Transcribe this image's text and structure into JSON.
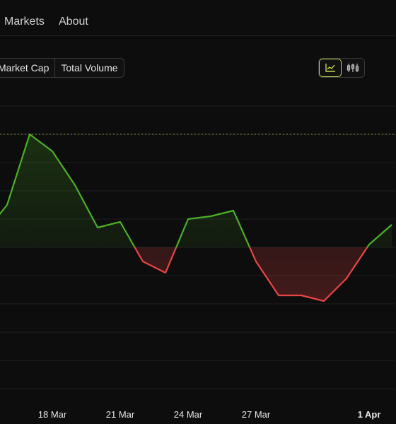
{
  "nav": {
    "markets_label": "Markets",
    "about_label": "About"
  },
  "toggle": {
    "market_cap_label": "Market Cap",
    "total_volume_label": "Total Volume"
  },
  "chart_types": {
    "active": "line",
    "options": [
      "line-chart-icon",
      "candlestick-icon"
    ]
  },
  "colors": {
    "up": "#4caf25",
    "down": "#e84545",
    "reference": "#7a9a3a",
    "accent": "#c7d64a"
  },
  "chart_data": {
    "type": "line",
    "x_ticks": [
      {
        "label": "18 Mar",
        "bold": false
      },
      {
        "label": "21 Mar",
        "bold": false
      },
      {
        "label": "24 Mar",
        "bold": false
      },
      {
        "label": "27 Mar",
        "bold": false
      },
      {
        "label": "1 Apr",
        "bold": true
      }
    ],
    "x_tick_index": [
      3,
      6,
      9,
      12,
      17
    ],
    "y_range": [
      0,
      100
    ],
    "baseline": 50,
    "reference_line": 90,
    "values": [
      55,
      65,
      90,
      84,
      72,
      57,
      59,
      45,
      41,
      60,
      61,
      63,
      45,
      33,
      33,
      31,
      39,
      51,
      58
    ],
    "grid": true
  }
}
